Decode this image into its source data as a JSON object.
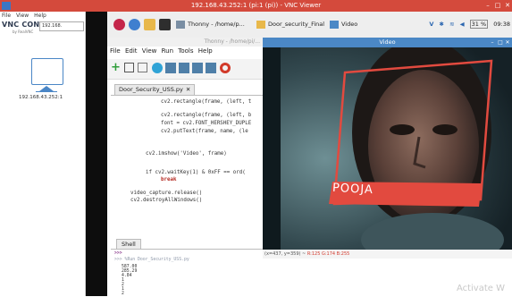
{
  "vnc_window": {
    "title": "192.168.43.252:1 (pi:1 (pi)) - VNC Viewer",
    "minimize": "–",
    "maximize": "□",
    "close": "✕"
  },
  "vnc_connect": {
    "menu": [
      "File",
      "View",
      "Help"
    ],
    "logo": "VNC CONNECT",
    "logo_sub": "by RealVNC",
    "address_value": "192.168.",
    "computer_label": "192.168.43.252:1"
  },
  "taskbar": {
    "tasks": [
      {
        "label": "Thonny - /home/p..."
      },
      {
        "label": "Door_security_Final"
      },
      {
        "label": "Video"
      }
    ],
    "tray": {
      "battery_text": "31 %",
      "clock": "09:38"
    },
    "icons": [
      "raspberry-icon",
      "globe-icon",
      "folder-icon",
      "terminal-icon"
    ]
  },
  "thonny": {
    "title": "Thonny - /home/pi/...",
    "menu": [
      "File",
      "Edit",
      "View",
      "Run",
      "Tools",
      "Help"
    ],
    "file_tab": "Door_Security_USS.py",
    "code_lines": [
      "cv2.rectangle(frame, (left, t",
      "cv2.rectangle(frame, (left, b",
      "font = cv2.FONT_HERSHEY_DUPLE",
      "cv2.putText(frame, name, (le",
      "cv2.imshow('Video', frame)",
      "if cv2.waitKey(1) & 0xFF == ord(",
      "break",
      "video_capture.release()",
      "cv2.destroyAllWindows()"
    ],
    "shell_tab": "Shell",
    "shell_lines": [
      ">>>",
      ">>> %Run Door_Security_USS.py",
      "587.00",
      "285.29",
      "4.84",
      "1",
      "2",
      "1",
      "2"
    ]
  },
  "video_window": {
    "title": "Video",
    "detected_name": "POOJA",
    "status_coords": "(x=437, y=359) ~",
    "status_rgb": "R:125 G:174 B:255"
  },
  "watermark": "Activate W",
  "colors": {
    "vnc_titlebar": "#d44a3c",
    "video_titlebar": "#4b88c6",
    "face_box": "#e24a3f",
    "name_label": "#e24a3f"
  }
}
